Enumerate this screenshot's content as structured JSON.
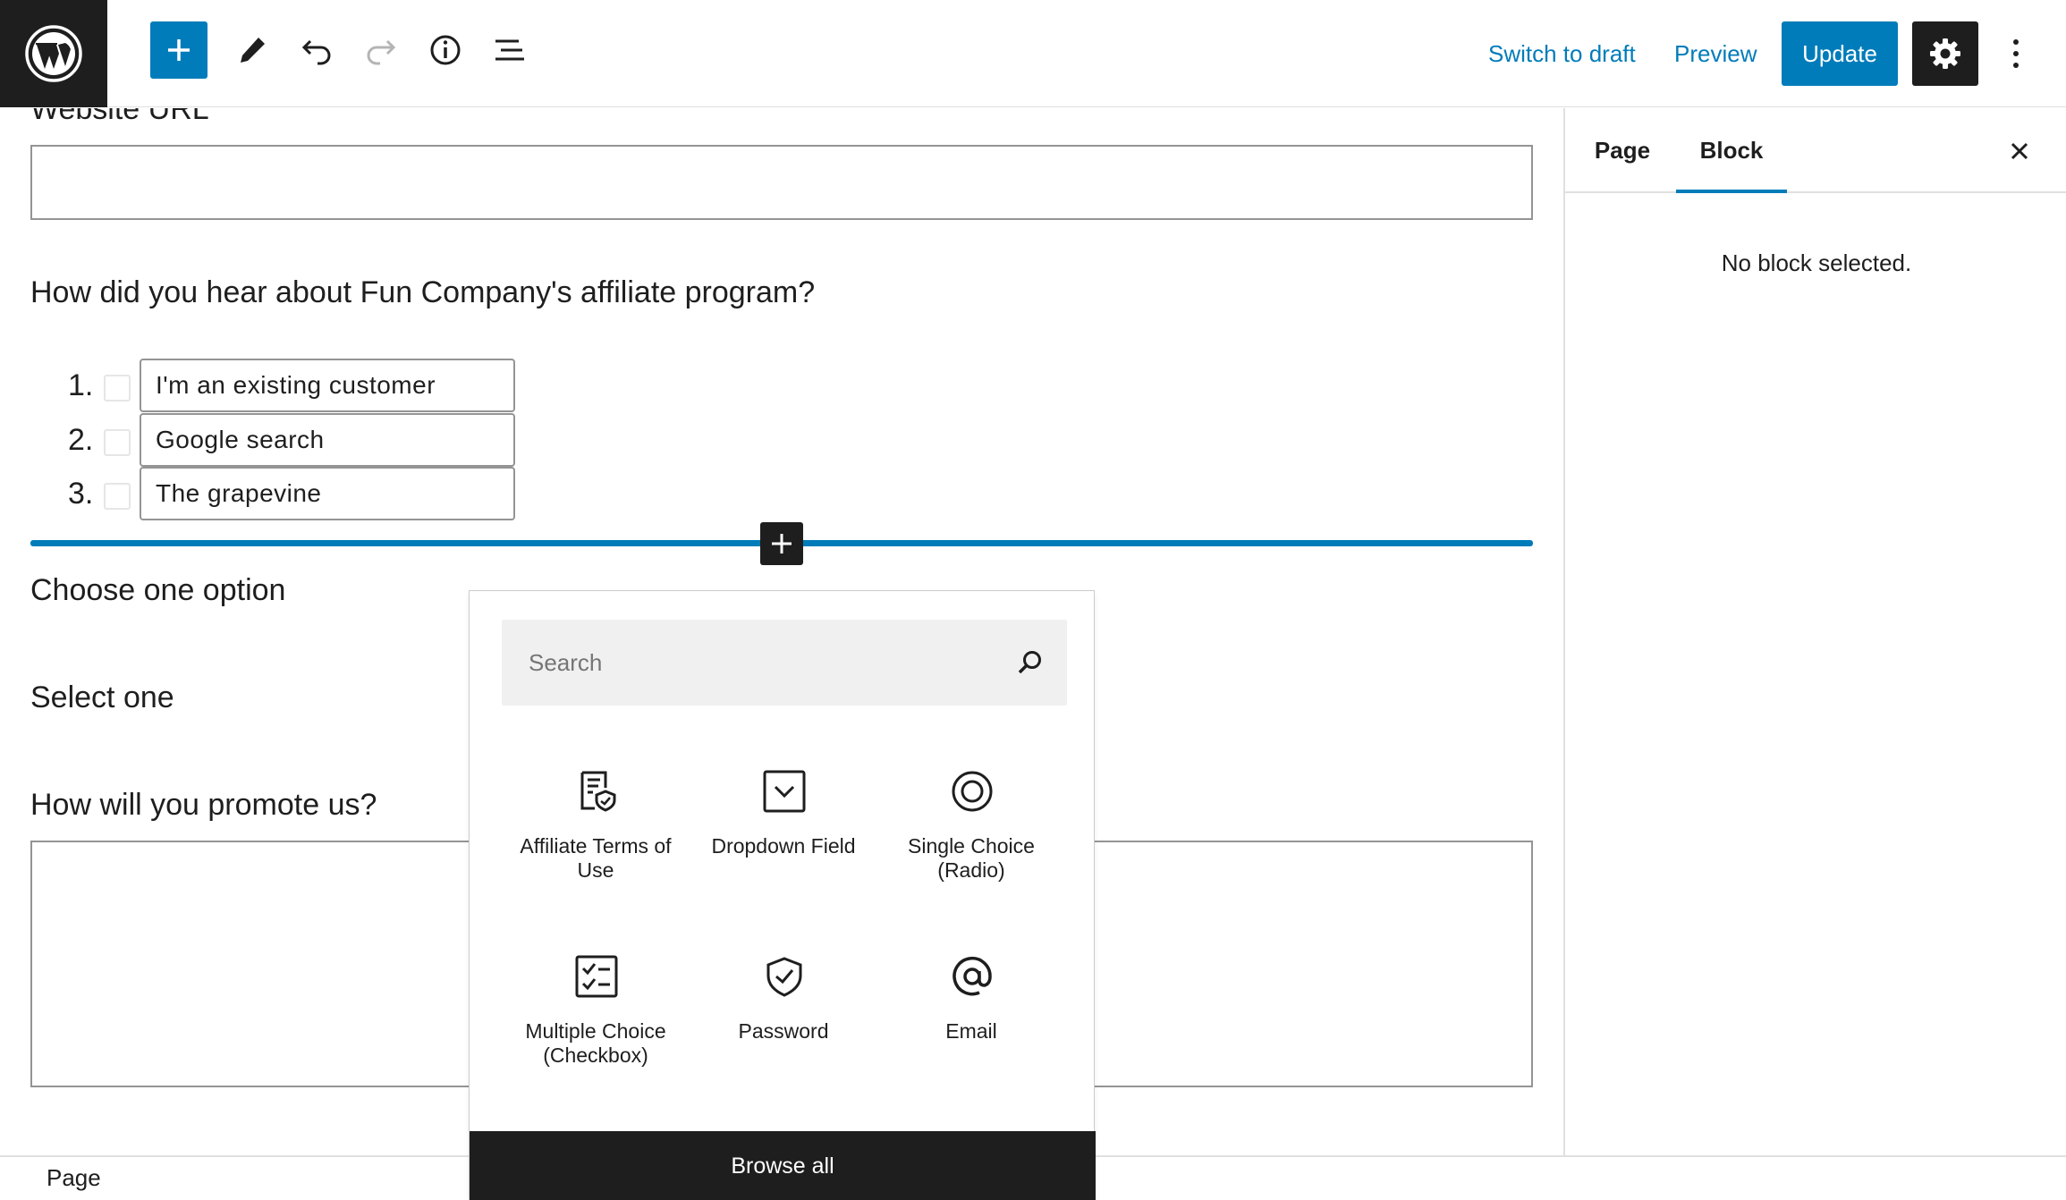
{
  "toolbar": {
    "switch_to_draft": "Switch to draft",
    "preview": "Preview",
    "update": "Update"
  },
  "form": {
    "website_url_label": "Website URL",
    "hear_about_label": "How did you hear about Fun Company's affiliate program?",
    "choices": [
      {
        "num": "1.",
        "value": "I'm an existing customer"
      },
      {
        "num": "2.",
        "value": "Google search"
      },
      {
        "num": "3.",
        "value": "The grapevine"
      }
    ],
    "choose_one_label": "Choose one option",
    "select_one_label": "Select one",
    "promote_label": "How will you promote us?"
  },
  "sidebar": {
    "tabs": [
      "Page",
      "Block"
    ],
    "active_tab": "Block",
    "empty_message": "No block selected."
  },
  "footer": {
    "breadcrumb": "Page"
  },
  "inserter": {
    "search_placeholder": "Search",
    "blocks": [
      {
        "label": "Affiliate Terms of Use",
        "icon": "terms-document-icon"
      },
      {
        "label": "Dropdown Field",
        "icon": "dropdown-icon"
      },
      {
        "label": "Single Choice (Radio)",
        "icon": "radio-icon"
      },
      {
        "label": "Multiple Choice (Checkbox)",
        "icon": "checklist-icon"
      },
      {
        "label": "Password",
        "icon": "shield-check-icon"
      },
      {
        "label": "Email",
        "icon": "at-sign-icon"
      }
    ],
    "browse_all": "Browse all"
  },
  "colors": {
    "accent": "#007cba",
    "dark": "#1e1e1e",
    "border": "#949494"
  }
}
